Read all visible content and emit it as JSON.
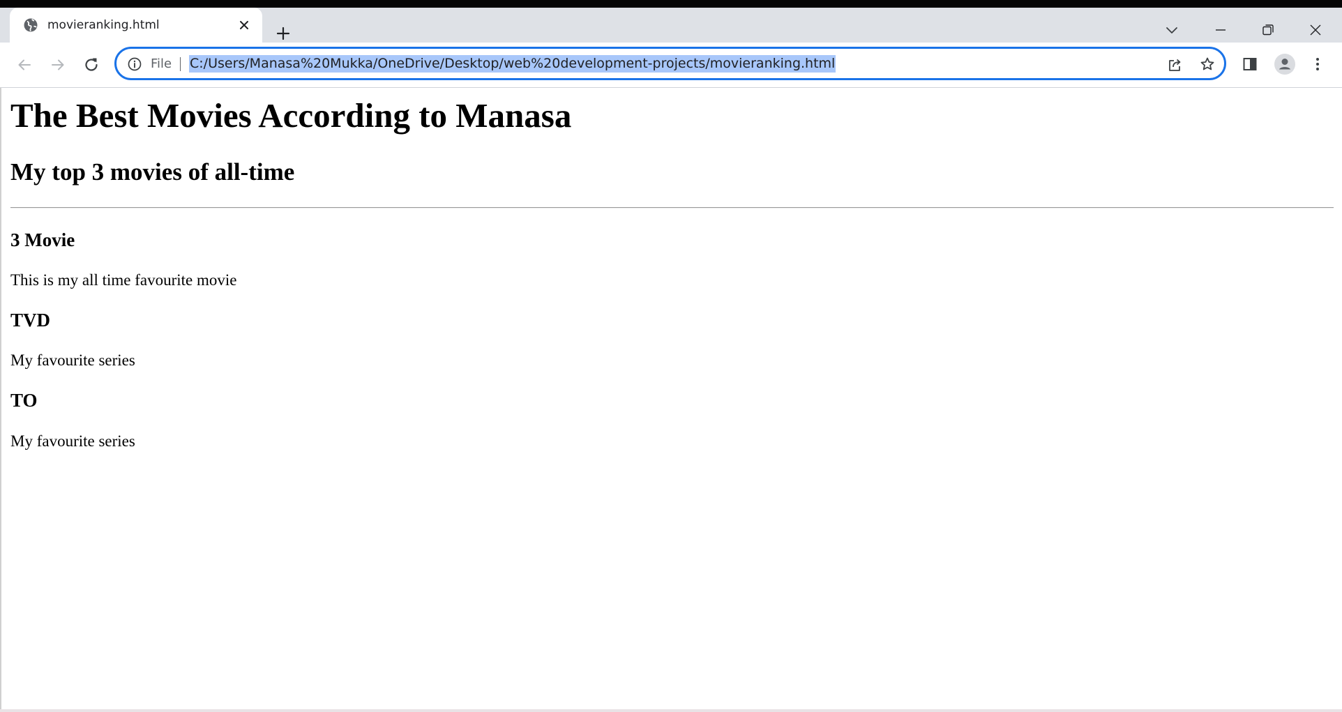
{
  "browser": {
    "tab": {
      "title": "movieranking.html"
    },
    "address_bar": {
      "scheme_label": "File",
      "url": "C:/Users/Manasa%20Mukka/OneDrive/Desktop/web%20development-projects/movieranking.html"
    },
    "colors": {
      "tabbar_bg": "#dee1e6",
      "omnibox_border": "#1a73e8",
      "url_selection": "#a8c7fa"
    }
  },
  "page": {
    "title": "The Best Movies According to Manasa",
    "subtitle": "My top 3 movies of all-time",
    "items": [
      {
        "heading": "3 Movie",
        "text": "This is my all time favourite movie"
      },
      {
        "heading": "TVD",
        "text": "My favourite series"
      },
      {
        "heading": "TO",
        "text": "My favourite series"
      }
    ]
  }
}
